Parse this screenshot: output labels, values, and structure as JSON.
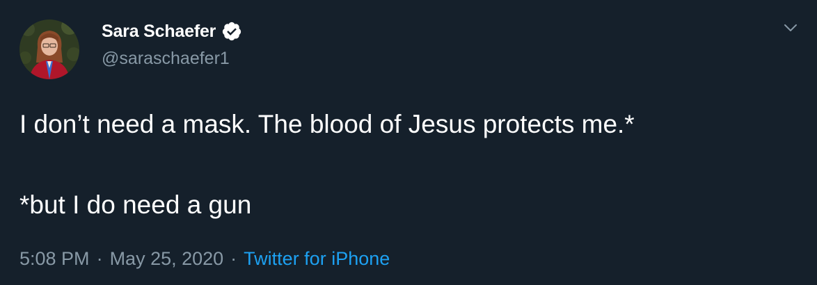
{
  "tweet": {
    "display_name": "Sara Schaefer",
    "handle": "@saraschaefer1",
    "verified": true,
    "text_line_1": "I don’t need a mask. The blood of Jesus protects me.*",
    "text_line_2": "*but I do need a gun",
    "time": "5:08 PM",
    "separator": "·",
    "date": "May 25, 2020",
    "source": "Twitter for iPhone"
  },
  "icons": {
    "verified": "verified-badge-icon",
    "menu": "chevron-down-icon"
  },
  "colors": {
    "background": "#15202b",
    "primary_text": "#ffffff",
    "secondary_text": "#8899a6",
    "link": "#1da1f2"
  }
}
